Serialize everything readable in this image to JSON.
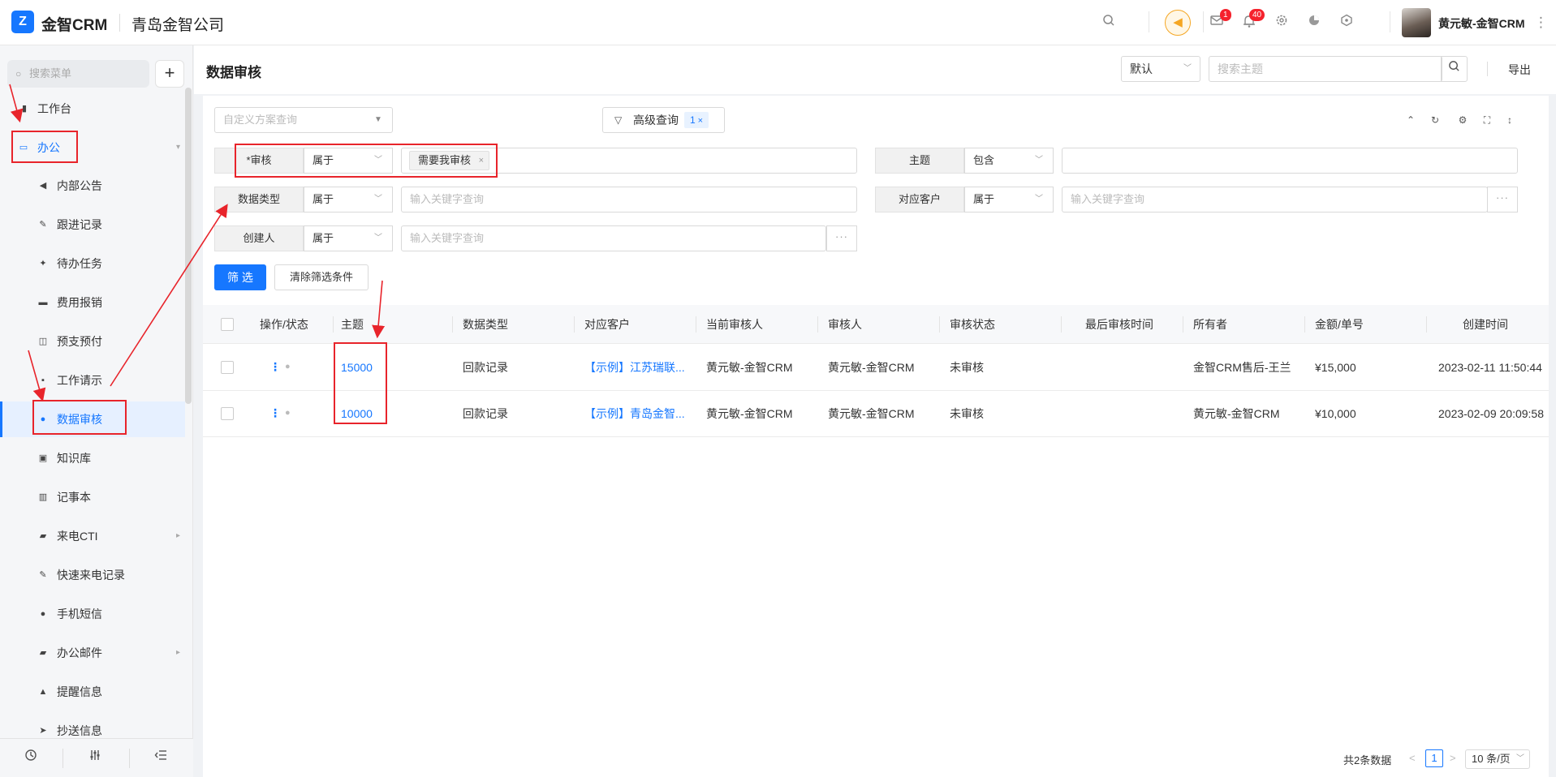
{
  "header": {
    "logo_glyph": "Z",
    "app_name": "金智CRM",
    "company": "青岛金智公司",
    "badges": {
      "messages": "1",
      "notifications": "40"
    },
    "user": "黄元敏-金智CRM"
  },
  "sidebar": {
    "search_placeholder": "搜索菜单",
    "add_label": "+",
    "items": [
      {
        "label": "工作台",
        "icon": "dashboard-icon",
        "glyph": "▮"
      },
      {
        "label": "办公",
        "icon": "computer-icon",
        "glyph": "▭"
      },
      {
        "label": "内部公告",
        "icon": "megaphone-icon",
        "glyph": "◀"
      },
      {
        "label": "跟进记录",
        "icon": "edit-icon",
        "glyph": "✎"
      },
      {
        "label": "待办任务",
        "icon": "pin-icon",
        "glyph": "✦"
      },
      {
        "label": "费用报销",
        "icon": "card-icon",
        "glyph": "▬"
      },
      {
        "label": "预支预付",
        "icon": "wallet-icon",
        "glyph": "◫"
      },
      {
        "label": "工作请示",
        "icon": "chat-icon",
        "glyph": "▪"
      },
      {
        "label": "数据审核",
        "icon": "user-check-icon",
        "glyph": "●"
      },
      {
        "label": "知识库",
        "icon": "book-icon",
        "glyph": "▣"
      },
      {
        "label": "记事本",
        "icon": "notebook-icon",
        "glyph": "▥"
      },
      {
        "label": "来电CTI",
        "icon": "folder-icon",
        "glyph": "▰"
      },
      {
        "label": "快速来电记录",
        "icon": "edit-icon",
        "glyph": "✎"
      },
      {
        "label": "手机短信",
        "icon": "message-icon",
        "glyph": "●"
      },
      {
        "label": "办公邮件",
        "icon": "folder-icon",
        "glyph": "▰"
      },
      {
        "label": "提醒信息",
        "icon": "bell-icon",
        "glyph": "▲"
      },
      {
        "label": "抄送信息",
        "icon": "send-icon",
        "glyph": "➤"
      }
    ]
  },
  "page": {
    "title": "数据审核",
    "view_select": "默认",
    "search_placeholder": "搜索主题",
    "export_label": "导出"
  },
  "filters": {
    "scheme_placeholder": "自定义方案查询",
    "advanced_label": "高级查询",
    "advanced_count": "1",
    "audit": {
      "label": "*审核",
      "op": "属于",
      "tag": "需要我审核"
    },
    "subject": {
      "label": "主题",
      "op": "包含"
    },
    "data_type": {
      "label": "数据类型",
      "op": "属于",
      "placeholder": "输入关键字查询"
    },
    "customer": {
      "label": "对应客户",
      "op": "属于",
      "placeholder": "输入关键字查询"
    },
    "creator": {
      "label": "创建人",
      "op": "属于",
      "placeholder": "输入关键字查询"
    },
    "more_label": "···",
    "filter_button": "筛 选",
    "clear_button": "清除筛选条件"
  },
  "table": {
    "columns": [
      "操作/状态",
      "主题",
      "数据类型",
      "对应客户",
      "当前审核人",
      "审核人",
      "审核状态",
      "最后审核时间",
      "所有者",
      "金额/单号",
      "创建时间"
    ],
    "rows": [
      {
        "subject": "15000",
        "type": "回款记录",
        "customer": "【示例】江苏瑞联...",
        "current_auditor": "黄元敏-金智CRM",
        "auditor": "黄元敏-金智CRM",
        "status": "未审核",
        "last_time": "",
        "owner": "金智CRM售后-王兰",
        "amount": "¥15,000",
        "created": "2023-02-11 11:50:44"
      },
      {
        "subject": "10000",
        "type": "回款记录",
        "customer": "【示例】青岛金智...",
        "current_auditor": "黄元敏-金智CRM",
        "auditor": "黄元敏-金智CRM",
        "status": "未审核",
        "last_time": "",
        "owner": "黄元敏-金智CRM",
        "amount": "¥10,000",
        "created": "2023-02-09 20:09:58"
      }
    ]
  },
  "pager": {
    "total": "共2条数据",
    "current": "1",
    "page_size": "10 条/页"
  },
  "colors": {
    "accent": "#1677ff",
    "annotation": "#e8242b",
    "warning": "#f5a623"
  }
}
